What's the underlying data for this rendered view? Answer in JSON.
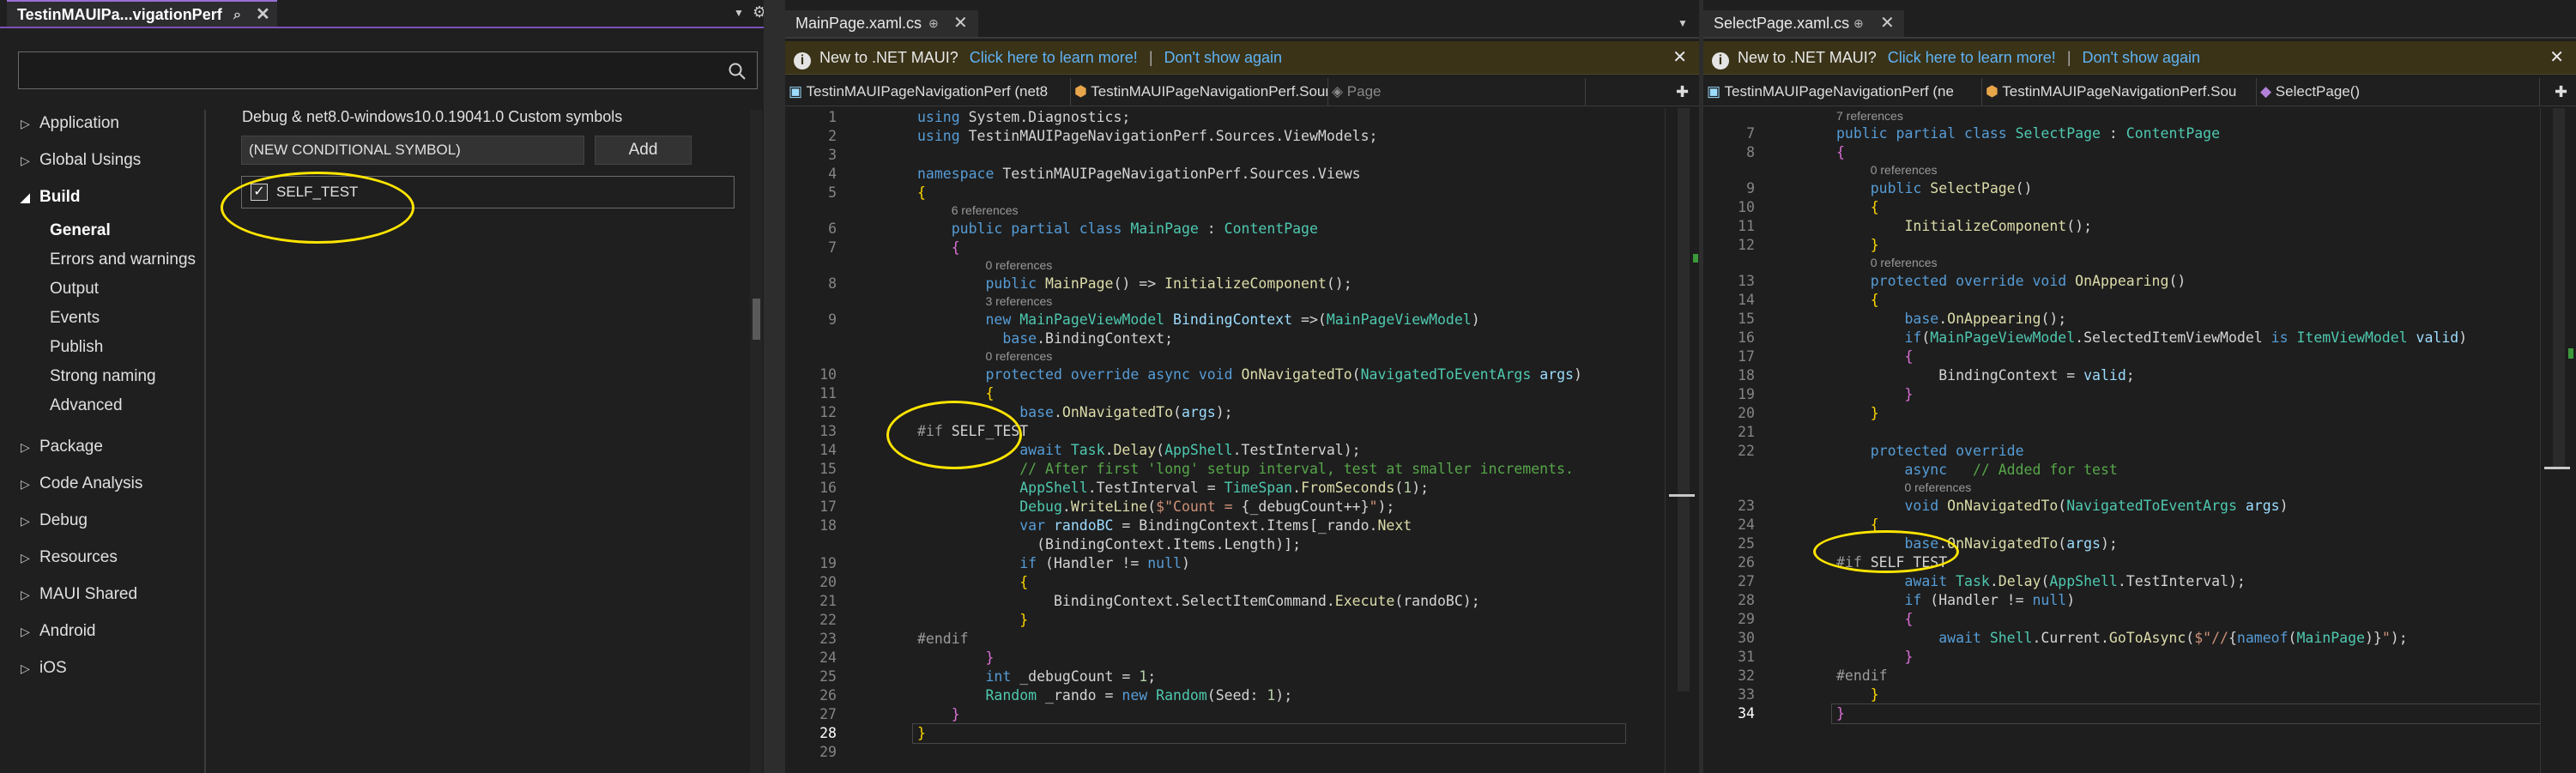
{
  "left_panel": {
    "tab_title": "TestinMAUIPa...vigationPerf",
    "search": {
      "value": "",
      "placeholder": ""
    },
    "nav": [
      {
        "label": "Application",
        "expanded": false
      },
      {
        "label": "Global Usings",
        "expanded": false
      },
      {
        "label": "Build",
        "expanded": true
      },
      {
        "label": "General",
        "sub": true,
        "selected": true
      },
      {
        "label": "Errors and warnings",
        "sub": true
      },
      {
        "label": "Output",
        "sub": true
      },
      {
        "label": "Events",
        "sub": true
      },
      {
        "label": "Publish",
        "sub": true
      },
      {
        "label": "Strong naming",
        "sub": true
      },
      {
        "label": "Advanced",
        "sub": true
      },
      {
        "label": "Package",
        "expanded": false
      },
      {
        "label": "Code Analysis",
        "expanded": false
      },
      {
        "label": "Debug",
        "expanded": false
      },
      {
        "label": "Resources",
        "expanded": false
      },
      {
        "label": "MAUI Shared",
        "expanded": false
      },
      {
        "label": "Android",
        "expanded": false
      },
      {
        "label": "iOS",
        "expanded": false
      }
    ],
    "section_title": "Debug & net8.0-windows10.0.19041.0 Custom symbols",
    "symbol_input": "(NEW CONDITIONAL SYMBOL)",
    "add_label": "Add",
    "symbol_item": "SELF_TEST",
    "symbol_checked": true
  },
  "editor1": {
    "tab_title": "MainPage.xaml.cs",
    "tab_suffix": "⊕",
    "info_text": "New to .NET MAUI?",
    "info_link1": "Click here to learn more!",
    "info_link2": "Don't show again",
    "nav1": "TestinMAUIPageNavigationPerf (net8",
    "nav2": "TestinMAUIPageNavigationPerf.Sourc",
    "nav3": "Page",
    "lines": [
      {
        "n": "1",
        "t": [
          [
            "kw",
            "using "
          ],
          [
            "pu",
            "System.Diagnostics;"
          ]
        ]
      },
      {
        "n": "2",
        "t": [
          [
            "kw",
            "using "
          ],
          [
            "pu",
            "TestinMAUIPageNavigationPerf.Sources.ViewModels;"
          ]
        ]
      },
      {
        "n": "3",
        "t": []
      },
      {
        "n": "4",
        "t": [
          [
            "kw",
            "namespace "
          ],
          [
            "pu",
            "TestinMAUIPageNavigationPerf.Sources.Views"
          ]
        ]
      },
      {
        "n": "5",
        "t": [
          [
            "br1",
            "{"
          ]
        ]
      },
      {
        "n": "6",
        "ref": "6 references",
        "t": [
          [
            "kw",
            "    public partial class "
          ],
          [
            "ty",
            "MainPage"
          ],
          [
            "pu",
            " : "
          ],
          [
            "ty",
            "ContentPage"
          ]
        ]
      },
      {
        "n": "7",
        "t": [
          [
            "br2",
            "    {"
          ]
        ]
      },
      {
        "n": "8",
        "ref": "0 references",
        "t": [
          [
            "kw",
            "        public "
          ],
          [
            "fn",
            "MainPage"
          ],
          [
            "pu",
            "() => "
          ],
          [
            "fn",
            "InitializeComponent"
          ],
          [
            "pu",
            "();"
          ]
        ]
      },
      {
        "n": "9",
        "ref": "3 references",
        "t": [
          [
            "kw",
            "        new "
          ],
          [
            "ty",
            "MainPageViewModel "
          ],
          [
            "id",
            "BindingContext"
          ],
          [
            "pu",
            " =>("
          ],
          [
            "ty",
            "MainPageViewModel"
          ],
          [
            "pu",
            ")"
          ]
        ]
      },
      {
        "n": "",
        "t": [
          [
            "kw",
            "          base"
          ],
          [
            "pu",
            ".BindingContext;"
          ]
        ]
      },
      {
        "n": "10",
        "ref": "0 references",
        "t": [
          [
            "kw",
            "        protected override async void "
          ],
          [
            "fn",
            "OnNavigatedTo"
          ],
          [
            "pu",
            "("
          ],
          [
            "ty",
            "NavigatedToEventArgs "
          ],
          [
            "id",
            "args"
          ],
          [
            "pu",
            ")"
          ]
        ]
      },
      {
        "n": "11",
        "t": [
          [
            "br1",
            "        {"
          ]
        ]
      },
      {
        "n": "12",
        "t": [
          [
            "kw",
            "            base"
          ],
          [
            "pu",
            "."
          ],
          [
            "fn",
            "OnNavigatedTo"
          ],
          [
            "pu",
            "("
          ],
          [
            "id",
            "args"
          ],
          [
            "pu",
            ");"
          ]
        ]
      },
      {
        "n": "13",
        "t": [
          [
            "pp",
            "#if "
          ],
          [
            "pu",
            "SELF_TEST"
          ]
        ]
      },
      {
        "n": "14",
        "t": [
          [
            "kw",
            "            await "
          ],
          [
            "ty",
            "Task"
          ],
          [
            "pu",
            "."
          ],
          [
            "fn",
            "Delay"
          ],
          [
            "pu",
            "("
          ],
          [
            "ty",
            "AppShell"
          ],
          [
            "pu",
            ".TestInterval);"
          ]
        ]
      },
      {
        "n": "15",
        "t": [
          [
            "cm",
            "            // After first 'long' setup interval, test at smaller increments."
          ]
        ]
      },
      {
        "n": "16",
        "t": [
          [
            "ty",
            "            AppShell"
          ],
          [
            "pu",
            ".TestInterval = "
          ],
          [
            "ty",
            "TimeSpan"
          ],
          [
            "pu",
            "."
          ],
          [
            "fn",
            "FromSeconds"
          ],
          [
            "pu",
            "("
          ],
          [
            "num",
            "1"
          ],
          [
            "pu",
            ");"
          ]
        ]
      },
      {
        "n": "17",
        "t": [
          [
            "ty",
            "            Debug"
          ],
          [
            "pu",
            "."
          ],
          [
            "fn",
            "WriteLine"
          ],
          [
            "pu",
            "("
          ],
          [
            "str",
            "$\"Count = "
          ],
          [
            "pu",
            "{_debugCount++}"
          ],
          [
            "str",
            "\""
          ],
          [
            "pu",
            ");"
          ]
        ]
      },
      {
        "n": "18",
        "t": [
          [
            "kw",
            "            var "
          ],
          [
            "id",
            "randoBC"
          ],
          [
            "pu",
            " = BindingContext.Items[_rando."
          ],
          [
            "fn",
            "Next"
          ]
        ]
      },
      {
        "n": "",
        "t": [
          [
            "pu",
            "              (BindingContext.Items.Length)];"
          ]
        ]
      },
      {
        "n": "19",
        "t": [
          [
            "kw",
            "            if "
          ],
          [
            "pu",
            "(Handler != "
          ],
          [
            "kw",
            "null"
          ],
          [
            "pu",
            ")"
          ]
        ]
      },
      {
        "n": "20",
        "t": [
          [
            "br1",
            "            {"
          ]
        ]
      },
      {
        "n": "21",
        "t": [
          [
            "pu",
            "                BindingContext.SelectItemCommand."
          ],
          [
            "fn",
            "Execute"
          ],
          [
            "pu",
            "(randoBC);"
          ]
        ]
      },
      {
        "n": "22",
        "t": [
          [
            "br1",
            "            }"
          ]
        ]
      },
      {
        "n": "23",
        "t": [
          [
            "pp",
            "#endif"
          ]
        ]
      },
      {
        "n": "24",
        "t": [
          [
            "br2",
            "        }"
          ]
        ]
      },
      {
        "n": "25",
        "t": [
          [
            "kw",
            "        int "
          ],
          [
            "pu",
            "_debugCount = "
          ],
          [
            "num",
            "1"
          ],
          [
            "pu",
            ";"
          ]
        ]
      },
      {
        "n": "26",
        "t": [
          [
            "ty",
            "        Random "
          ],
          [
            "pu",
            "_rando = "
          ],
          [
            "kw",
            "new "
          ],
          [
            "ty",
            "Random"
          ],
          [
            "pu",
            "(Seed: "
          ],
          [
            "num",
            "1"
          ],
          [
            "pu",
            ");"
          ]
        ]
      },
      {
        "n": "27",
        "t": [
          [
            "br2",
            "    }"
          ]
        ]
      },
      {
        "n": "28",
        "t": [
          [
            "br1",
            "}"
          ]
        ]
      },
      {
        "n": "29",
        "t": []
      }
    ]
  },
  "editor2": {
    "tab_title": "SelectPage.xaml.cs",
    "tab_suffix": "⊕",
    "info_text": "New to .NET MAUI?",
    "info_link1": "Click here to learn more!",
    "info_link2": "Don't show again",
    "nav1": "TestinMAUIPageNavigationPerf (ne",
    "nav2": "TestinMAUIPageNavigationPerf.Sou",
    "nav3": "SelectPage()",
    "top_ref": "7 references",
    "lines": [
      {
        "n": "7",
        "t": [
          [
            "kw",
            "public partial class "
          ],
          [
            "ty",
            "SelectPage"
          ],
          [
            "pu",
            " : "
          ],
          [
            "ty",
            "ContentPage"
          ]
        ]
      },
      {
        "n": "8",
        "t": [
          [
            "br2",
            "{"
          ]
        ]
      },
      {
        "n": "9",
        "ref": "0 references",
        "t": [
          [
            "kw",
            "    public "
          ],
          [
            "fn",
            "SelectPage"
          ],
          [
            "pu",
            "()"
          ]
        ]
      },
      {
        "n": "10",
        "t": [
          [
            "br1",
            "    {"
          ]
        ]
      },
      {
        "n": "11",
        "t": [
          [
            "fn",
            "        InitializeComponent"
          ],
          [
            "pu",
            "();"
          ]
        ]
      },
      {
        "n": "12",
        "t": [
          [
            "br1",
            "    }"
          ]
        ]
      },
      {
        "n": "13",
        "ref": "0 references",
        "t": [
          [
            "kw",
            "    protected override void "
          ],
          [
            "fn",
            "OnAppearing"
          ],
          [
            "pu",
            "()"
          ]
        ]
      },
      {
        "n": "14",
        "t": [
          [
            "br1",
            "    {"
          ]
        ]
      },
      {
        "n": "15",
        "t": [
          [
            "kw",
            "        base"
          ],
          [
            "pu",
            "."
          ],
          [
            "fn",
            "OnAppearing"
          ],
          [
            "pu",
            "();"
          ]
        ]
      },
      {
        "n": "16",
        "t": [
          [
            "kw",
            "        if"
          ],
          [
            "pu",
            "("
          ],
          [
            "ty",
            "MainPageViewModel"
          ],
          [
            "pu",
            ".SelectedItemViewModel "
          ],
          [
            "kw",
            "is "
          ],
          [
            "ty",
            "ItemViewModel "
          ],
          [
            "id",
            "valid"
          ],
          [
            "pu",
            ")"
          ]
        ]
      },
      {
        "n": "17",
        "t": [
          [
            "br2",
            "        {"
          ]
        ]
      },
      {
        "n": "18",
        "t": [
          [
            "pu",
            "            BindingContext = "
          ],
          [
            "id",
            "valid"
          ],
          [
            "pu",
            ";"
          ]
        ]
      },
      {
        "n": "19",
        "t": [
          [
            "br2",
            "        }"
          ]
        ]
      },
      {
        "n": "20",
        "t": [
          [
            "br1",
            "    }"
          ]
        ]
      },
      {
        "n": "21",
        "t": []
      },
      {
        "n": "22",
        "t": [
          [
            "kw",
            "    protected override"
          ]
        ]
      },
      {
        "n": "",
        "t": [
          [
            "kw",
            "        async "
          ],
          [
            "cm",
            "  // Added for test"
          ]
        ]
      },
      {
        "n": "23",
        "ref": "0 references",
        "t": [
          [
            "kw",
            "        void "
          ],
          [
            "fn",
            "OnNavigatedTo"
          ],
          [
            "pu",
            "("
          ],
          [
            "ty",
            "NavigatedToEventArgs "
          ],
          [
            "id",
            "args"
          ],
          [
            "pu",
            ")"
          ]
        ]
      },
      {
        "n": "24",
        "t": [
          [
            "br1",
            "    {"
          ]
        ]
      },
      {
        "n": "25",
        "t": [
          [
            "kw",
            "        base"
          ],
          [
            "pu",
            "."
          ],
          [
            "fn",
            "OnNavigatedTo"
          ],
          [
            "pu",
            "("
          ],
          [
            "id",
            "args"
          ],
          [
            "pu",
            ");"
          ]
        ]
      },
      {
        "n": "26",
        "t": [
          [
            "pp",
            "#if "
          ],
          [
            "pu",
            "SELF_TEST"
          ]
        ]
      },
      {
        "n": "27",
        "t": [
          [
            "kw",
            "        await "
          ],
          [
            "ty",
            "Task"
          ],
          [
            "pu",
            "."
          ],
          [
            "fn",
            "Delay"
          ],
          [
            "pu",
            "("
          ],
          [
            "ty",
            "AppShell"
          ],
          [
            "pu",
            ".TestInterval);"
          ]
        ]
      },
      {
        "n": "28",
        "t": [
          [
            "kw",
            "        if "
          ],
          [
            "pu",
            "(Handler != "
          ],
          [
            "kw",
            "null"
          ],
          [
            "pu",
            ")"
          ]
        ]
      },
      {
        "n": "29",
        "t": [
          [
            "br2",
            "        {"
          ]
        ]
      },
      {
        "n": "30",
        "t": [
          [
            "kw",
            "            await "
          ],
          [
            "ty",
            "Shell"
          ],
          [
            "pu",
            ".Current."
          ],
          [
            "fn",
            "GoToAsync"
          ],
          [
            "pu",
            "("
          ],
          [
            "str",
            "$\"//"
          ],
          [
            "pu",
            "{"
          ],
          [
            "kw",
            "nameof"
          ],
          [
            "pu",
            "("
          ],
          [
            "ty",
            "MainPage"
          ],
          [
            "pu",
            ")}"
          ],
          [
            "str",
            "\""
          ],
          [
            "pu",
            ");"
          ]
        ]
      },
      {
        "n": "31",
        "t": [
          [
            "br2",
            "        }"
          ]
        ]
      },
      {
        "n": "32",
        "t": [
          [
            "pp",
            "#endif"
          ]
        ]
      },
      {
        "n": "33",
        "t": [
          [
            "br1",
            "    }"
          ]
        ]
      },
      {
        "n": "34",
        "t": [
          [
            "br2",
            "}"
          ]
        ]
      }
    ]
  }
}
